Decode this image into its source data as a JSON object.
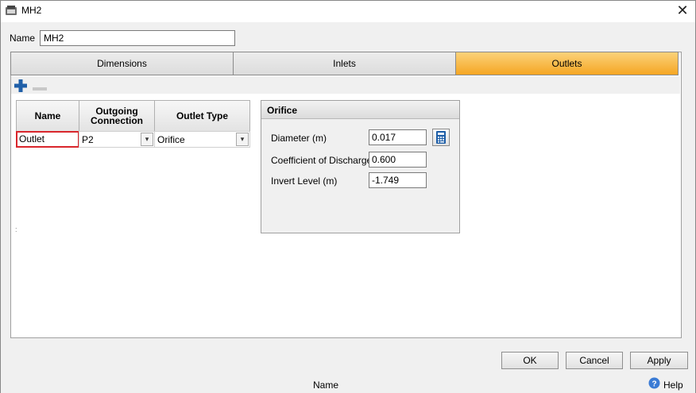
{
  "window": {
    "title": "MH2",
    "close_glyph": "✕"
  },
  "form": {
    "name_label": "Name",
    "name_value": "MH2"
  },
  "tabs": [
    {
      "label": "Dimensions",
      "active": false
    },
    {
      "label": "Inlets",
      "active": false
    },
    {
      "label": "Outlets",
      "active": true
    }
  ],
  "toolbar": {
    "add_icon": "plus-icon",
    "remove_icon": "minus-icon"
  },
  "outlets_grid": {
    "columns": [
      "Name",
      "Outgoing Connection",
      "Outlet Type"
    ],
    "rows": [
      {
        "name": "Outlet",
        "outgoing_connection": "P2",
        "outlet_type": "Orifice"
      }
    ]
  },
  "orifice": {
    "header": "Orifice",
    "fields": [
      {
        "label": "Diameter (m)",
        "value": "0.017"
      },
      {
        "label": "Coefficient of Discharge",
        "value": "0.600"
      },
      {
        "label": "Invert Level (m)",
        "value": "-1.749"
      }
    ]
  },
  "buttons": {
    "ok": "OK",
    "cancel": "Cancel",
    "apply": "Apply"
  },
  "status": {
    "field_name": "Name",
    "help": "Help"
  },
  "colors": {
    "active_tab": "#f5a623",
    "selected_cell_border": "#d9262c",
    "add_icon": "#1f5fa8"
  }
}
